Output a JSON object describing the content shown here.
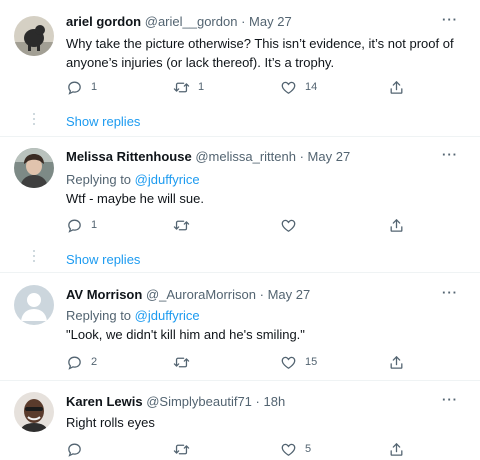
{
  "tweets": [
    {
      "name": "ariel gordon",
      "handle": "@ariel__gordon",
      "date": "May 27",
      "replying_label": "",
      "replying_to": "",
      "text": "Why take the picture otherwise? This isn’t evidence, it’s not proof of anyone’s injuries (or lack thereof). It’s a trophy.",
      "replies": "1",
      "retweets": "1",
      "likes": "14",
      "show_replies": "Show replies"
    },
    {
      "name": "Melissa Rittenhouse",
      "handle": "@melissa_rittenh",
      "date": "May 27",
      "replying_label": "Replying to",
      "replying_to": "@jduffyrice",
      "text": "Wtf - maybe he will sue.",
      "replies": "1",
      "retweets": "",
      "likes": "",
      "show_replies": "Show replies"
    },
    {
      "name": "AV Morrison",
      "handle": "@_AuroraMorrison",
      "date": "May 27",
      "replying_label": "Replying to",
      "replying_to": "@jduffyrice",
      "text": "\"Look, we didn't kill him and he's smiling.\"",
      "replies": "2",
      "retweets": "",
      "likes": "15",
      "show_replies": ""
    },
    {
      "name": "Karen Lewis",
      "handle": "@Simplybeautif71",
      "date": "18h",
      "replying_label": "",
      "replying_to": "",
      "text": "Right rolls eyes",
      "replies": "",
      "retweets": "",
      "likes": "5",
      "show_replies": ""
    }
  ],
  "separator": "·",
  "more_label": "···",
  "icons": [
    "reply-icon",
    "retweet-icon",
    "like-icon",
    "share-icon",
    "more-icon"
  ],
  "colors": {
    "link": "#1d9bf0",
    "secondary": "#536471",
    "text": "#0f1419"
  }
}
